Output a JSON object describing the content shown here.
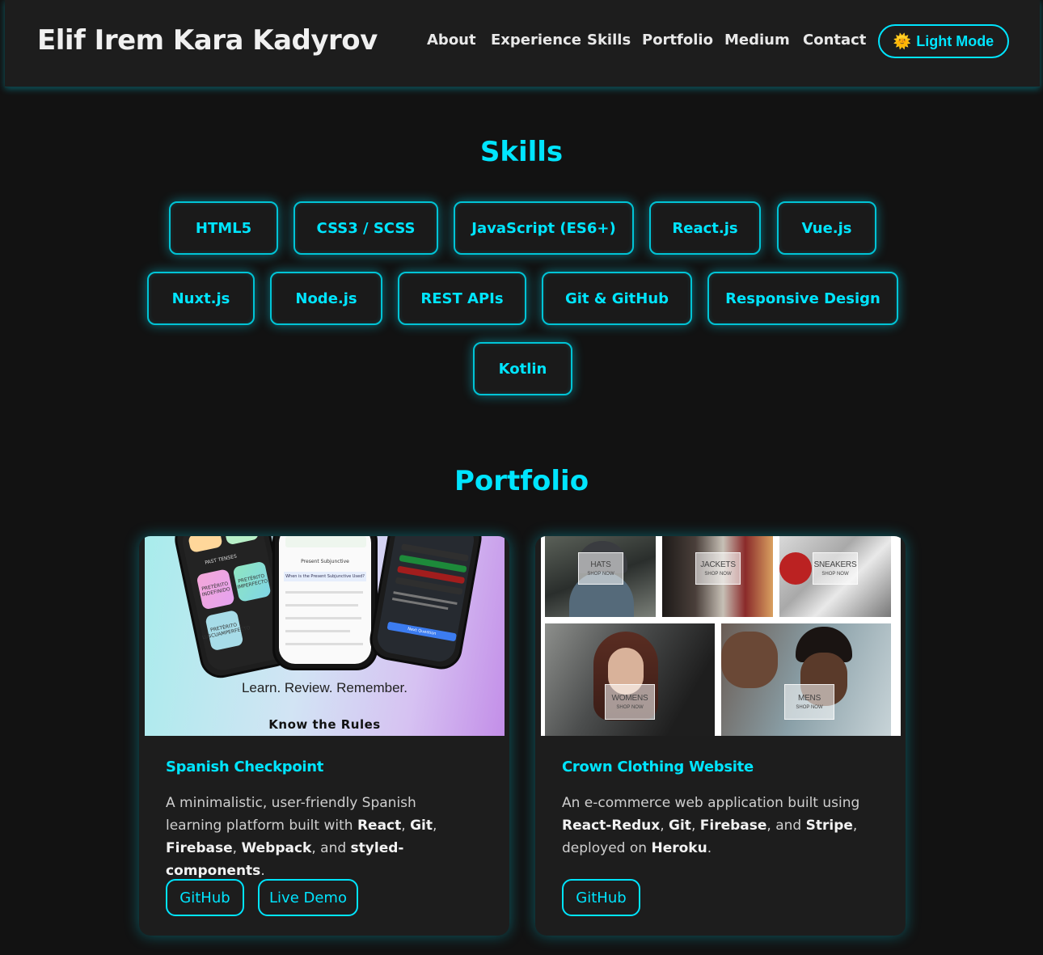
{
  "header": {
    "brand": "Elif Irem Kara Kadyrov",
    "nav": [
      "About",
      "Experience",
      "Skills",
      "Portfolio",
      "Medium",
      "Contact"
    ],
    "theme_toggle": {
      "icon": "sun-icon",
      "label": "Light Mode"
    }
  },
  "skills": {
    "title": "Skills",
    "items": [
      "HTML5",
      "CSS3 / SCSS",
      "JavaScript (ES6+)",
      "React.js",
      "Vue.js",
      "Nuxt.js",
      "Node.js",
      "REST APIs",
      "Git & GitHub",
      "Responsive Design",
      "Kotlin"
    ]
  },
  "portfolio": {
    "title": "Portfolio",
    "projects": [
      {
        "title": "Spanish Checkpoint",
        "desc_intro": "A minimalistic, user-friendly Spanish learning platform built with",
        "tech": [
          "React",
          "Git",
          "Firebase",
          "Webpack",
          "styled-components"
        ],
        "buttons": [
          "GitHub",
          "Live Demo"
        ],
        "image": {
          "tagline": "Learn. Review. Remember.",
          "subline": "Know the Rules",
          "screen_texts": [
            "PAST TENSES",
            "PRETÉRITO INDEFINIDO",
            "PRETÉRITO IMPERFECTO",
            "PRETÉRITO PLUSCUAMPERFECTO",
            "Present Subjunctive",
            "When is the Present Subjunctive Used?",
            "Next Question"
          ]
        }
      },
      {
        "title": "Crown Clothing Website",
        "desc_intro": "An e-commerce web application built using",
        "tech": [
          "React-Redux",
          "Git",
          "Firebase",
          "Stripe",
          "Heroku"
        ],
        "desc_outro": "deployed on",
        "buttons": [
          "GitHub"
        ],
        "image": {
          "categories": [
            "HATS",
            "JACKETS",
            "SNEAKERS",
            "WOMENS",
            "MENS"
          ],
          "shop_label": "SHOP NOW"
        }
      }
    ]
  },
  "colors": {
    "accent": "#00e5ff",
    "background": "#121212",
    "surface": "#1d1d1d"
  }
}
